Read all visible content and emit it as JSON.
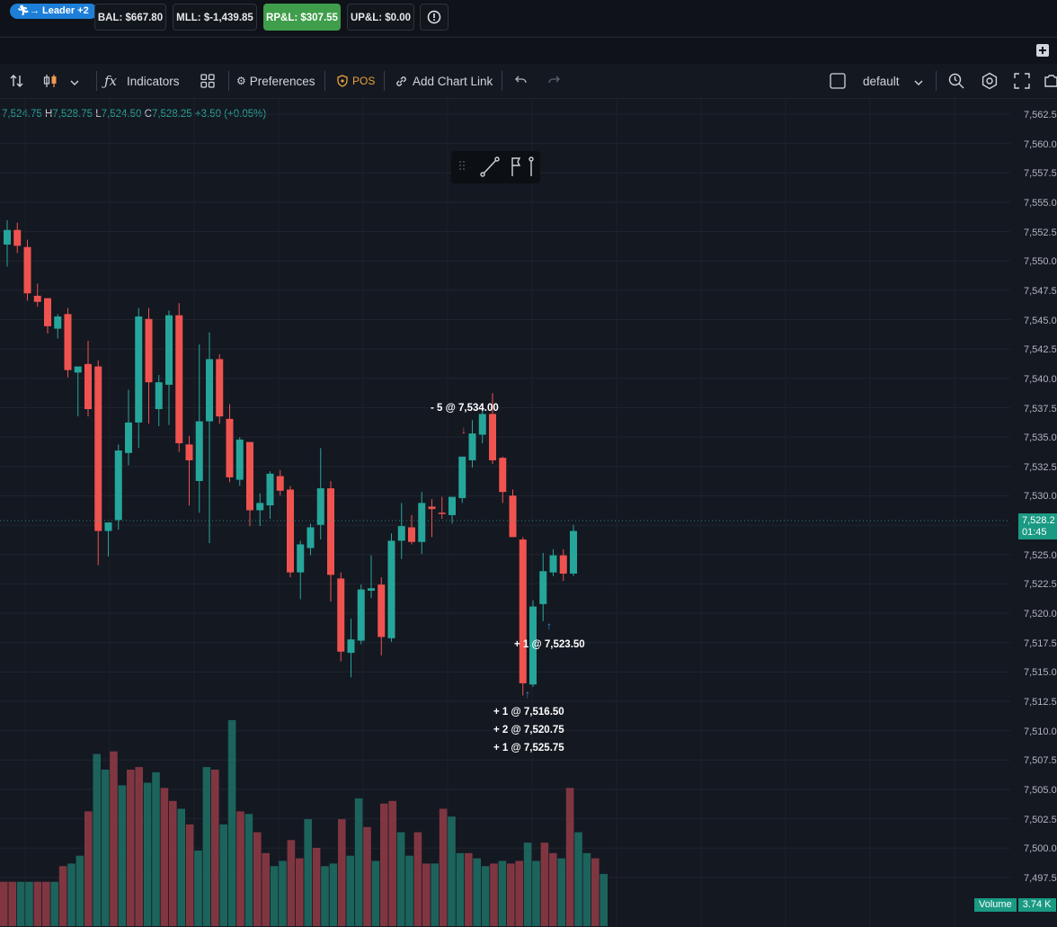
{
  "account_bar": {
    "leader_badge": "Leader +2",
    "balance": "BAL: $667.80",
    "mll": "MLL: $-1,439.85",
    "rpl": "RP&L: $307.55",
    "upl": "UP&L: $0.00",
    "colors": {
      "rpl_bg": "#3f9e4b",
      "leader_bg": "#1e7fd8"
    }
  },
  "toolbar": {
    "indicators": "Indicators",
    "preferences": "Preferences",
    "pos": "POS",
    "add_chart_link": "Add Chart Link",
    "layout": "default"
  },
  "ohlc": {
    "open": "7,524.75",
    "high_label": "H",
    "high": "7,528.75",
    "low_label": "L",
    "low": "7,524.50",
    "close_label": "C",
    "close": "7,528.25",
    "change": "+3.50 (+0.05%)"
  },
  "price_axis": {
    "ticks": [
      "7,562.5",
      "7,560.0",
      "7,557.5",
      "7,555.0",
      "7,552.5",
      "7,550.0",
      "7,547.5",
      "7,545.0",
      "7,542.5",
      "7,540.0",
      "7,537.5",
      "7,535.0",
      "7,532.5",
      "7,530.0",
      "7,527.5",
      "7,525.0",
      "7,522.5",
      "7,520.0",
      "7,517.5",
      "7,515.0",
      "7,512.5",
      "7,510.0",
      "7,507.5",
      "7,505.0",
      "7,502.5",
      "7,500.0",
      "7,497.5"
    ],
    "last_price": "7,528.2",
    "countdown": "01:45"
  },
  "volume_label": {
    "name": "Volume",
    "value": "3.74 K"
  },
  "colors": {
    "up": "#26a69a",
    "down": "#ef5350",
    "background": "#141821"
  },
  "chart_data": {
    "type": "candlestick",
    "ylim": [
      7495,
      7564
    ],
    "candles": [
      {
        "o": 7551.8,
        "h": 7553.8,
        "l": 7550.0,
        "c": 7553.0
      },
      {
        "o": 7553.0,
        "h": 7553.6,
        "l": 7551.1,
        "c": 7551.7
      },
      {
        "o": 7551.6,
        "h": 7552.2,
        "l": 7547.2,
        "c": 7547.8
      },
      {
        "o": 7547.6,
        "h": 7548.6,
        "l": 7546.7,
        "c": 7547.1
      },
      {
        "o": 7547.4,
        "h": 7547.4,
        "l": 7544.5,
        "c": 7545.1
      },
      {
        "o": 7544.9,
        "h": 7546.1,
        "l": 7544.1,
        "c": 7545.9
      },
      {
        "o": 7546.1,
        "h": 7546.6,
        "l": 7540.9,
        "c": 7541.5
      },
      {
        "o": 7541.3,
        "h": 7541.8,
        "l": 7537.7,
        "c": 7541.8
      },
      {
        "o": 7542.0,
        "h": 7543.9,
        "l": 7537.7,
        "c": 7538.3
      },
      {
        "o": 7541.8,
        "h": 7542.3,
        "l": 7525.5,
        "c": 7528.3
      },
      {
        "o": 7528.3,
        "h": 7528.6,
        "l": 7526.2,
        "c": 7529.0
      },
      {
        "o": 7529.2,
        "h": 7535.4,
        "l": 7528.4,
        "c": 7534.9
      },
      {
        "o": 7534.7,
        "h": 7539.9,
        "l": 7533.7,
        "c": 7537.2
      },
      {
        "o": 7537.2,
        "h": 7546.6,
        "l": 7535.1,
        "c": 7545.9
      },
      {
        "o": 7545.7,
        "h": 7546.6,
        "l": 7537.1,
        "c": 7540.5
      },
      {
        "o": 7538.3,
        "h": 7541.1,
        "l": 7536.9,
        "c": 7540.5
      },
      {
        "o": 7540.3,
        "h": 7546.4,
        "l": 7537.0,
        "c": 7546.0
      },
      {
        "o": 7546.0,
        "h": 7547.0,
        "l": 7534.8,
        "c": 7535.5
      },
      {
        "o": 7535.4,
        "h": 7536.1,
        "l": 7530.4,
        "c": 7534.1
      },
      {
        "o": 7532.4,
        "h": 7543.6,
        "l": 7529.8,
        "c": 7537.3
      },
      {
        "o": 7537.3,
        "h": 7544.6,
        "l": 7527.3,
        "c": 7542.4
      },
      {
        "o": 7542.4,
        "h": 7542.8,
        "l": 7537.1,
        "c": 7537.7
      },
      {
        "o": 7537.5,
        "h": 7538.7,
        "l": 7532.3,
        "c": 7532.7
      },
      {
        "o": 7532.5,
        "h": 7536.0,
        "l": 7532.0,
        "c": 7535.8
      },
      {
        "o": 7535.6,
        "h": 7535.6,
        "l": 7528.7,
        "c": 7530.0
      },
      {
        "o": 7530.0,
        "h": 7531.4,
        "l": 7528.7,
        "c": 7530.6
      },
      {
        "o": 7530.4,
        "h": 7533.2,
        "l": 7529.3,
        "c": 7533.0
      },
      {
        "o": 7532.8,
        "h": 7533.3,
        "l": 7531.2,
        "c": 7531.6
      },
      {
        "o": 7531.7,
        "h": 7532.0,
        "l": 7524.5,
        "c": 7524.9
      },
      {
        "o": 7524.9,
        "h": 7527.5,
        "l": 7522.7,
        "c": 7527.2
      },
      {
        "o": 7526.9,
        "h": 7528.9,
        "l": 7526.3,
        "c": 7528.6
      },
      {
        "o": 7528.8,
        "h": 7535.1,
        "l": 7527.6,
        "c": 7531.8
      },
      {
        "o": 7531.8,
        "h": 7532.4,
        "l": 7522.5,
        "c": 7524.7
      },
      {
        "o": 7524.4,
        "h": 7524.9,
        "l": 7517.6,
        "c": 7518.4
      },
      {
        "o": 7518.3,
        "h": 7521.1,
        "l": 7516.3,
        "c": 7519.4
      },
      {
        "o": 7519.3,
        "h": 7523.9,
        "l": 7519.0,
        "c": 7523.5
      },
      {
        "o": 7523.4,
        "h": 7526.3,
        "l": 7522.8,
        "c": 7523.6
      },
      {
        "o": 7523.9,
        "h": 7524.5,
        "l": 7518.1,
        "c": 7519.6
      },
      {
        "o": 7519.5,
        "h": 7528.1,
        "l": 7519.2,
        "c": 7527.5
      },
      {
        "o": 7527.5,
        "h": 7530.6,
        "l": 7526.0,
        "c": 7528.7
      },
      {
        "o": 7528.6,
        "h": 7529.6,
        "l": 7527.2,
        "c": 7527.4
      },
      {
        "o": 7527.4,
        "h": 7531.5,
        "l": 7526.4,
        "c": 7530.6
      },
      {
        "o": 7530.3,
        "h": 7530.9,
        "l": 7527.8,
        "c": 7530.1
      },
      {
        "o": 7529.8,
        "h": 7531.1,
        "l": 7529.3,
        "c": 7529.7
      },
      {
        "o": 7529.6,
        "h": 7530.8,
        "l": 7528.9,
        "c": 7531.1
      },
      {
        "o": 7531.0,
        "h": 7534.4,
        "l": 7530.6,
        "c": 7534.4
      },
      {
        "o": 7534.1,
        "h": 7537.4,
        "l": 7533.5,
        "c": 7536.3
      },
      {
        "o": 7536.2,
        "h": 7538.3,
        "l": 7535.5,
        "c": 7537.9
      },
      {
        "o": 7537.9,
        "h": 7539.6,
        "l": 7533.8,
        "c": 7534.1
      },
      {
        "o": 7534.3,
        "h": 7534.4,
        "l": 7530.6,
        "c": 7531.5
      },
      {
        "o": 7531.2,
        "h": 7531.7,
        "l": 7527.9,
        "c": 7527.8
      },
      {
        "o": 7527.6,
        "h": 7527.8,
        "l": 7514.8,
        "c": 7515.8
      },
      {
        "o": 7515.7,
        "h": 7522.6,
        "l": 7515.5,
        "c": 7522.1
      },
      {
        "o": 7522.3,
        "h": 7526.5,
        "l": 7520.9,
        "c": 7525.0
      },
      {
        "o": 7524.9,
        "h": 7526.8,
        "l": 7524.6,
        "c": 7526.3
      },
      {
        "o": 7526.3,
        "h": 7526.8,
        "l": 7524.2,
        "c": 7524.8
      },
      {
        "o": 7524.8,
        "h": 7528.8,
        "l": 7524.6,
        "c": 7528.3
      }
    ],
    "volume_ylim": [
      0,
      4000
    ],
    "volumes": [
      850,
      850,
      850,
      850,
      850,
      850,
      850,
      1150,
      1200,
      1350,
      2200,
      3300,
      3000,
      3350,
      2700,
      3000,
      3050,
      2750,
      2950,
      2650,
      2400,
      2250,
      1950,
      1450,
      3050,
      3000,
      1950,
      3950,
      2200,
      2150,
      1800,
      1400,
      1150,
      1250,
      1650,
      1300,
      2050,
      1500,
      1150,
      1200,
      2050,
      1350,
      2450,
      1900,
      1250,
      2350,
      2400,
      1800,
      1350,
      1800,
      1200,
      1200,
      2250,
      2100,
      1400,
      1400,
      1300,
      1150,
      1200,
      1250,
      1200,
      1250,
      1600,
      1250,
      1600,
      1400,
      1300,
      2650,
      1800,
      1400,
      1300,
      1000
    ]
  },
  "trade_annotations": [
    {
      "side": "sell",
      "text": "- 5 @ 7,534.00"
    },
    {
      "side": "buy",
      "text": "+ 1 @ 7,523.50"
    },
    {
      "side": "buy",
      "text": "+ 1 @ 7,516.50"
    },
    {
      "side": "buy",
      "text": "+ 2 @ 7,520.75"
    },
    {
      "side": "buy",
      "text": "+ 1 @ 7,525.75"
    }
  ]
}
